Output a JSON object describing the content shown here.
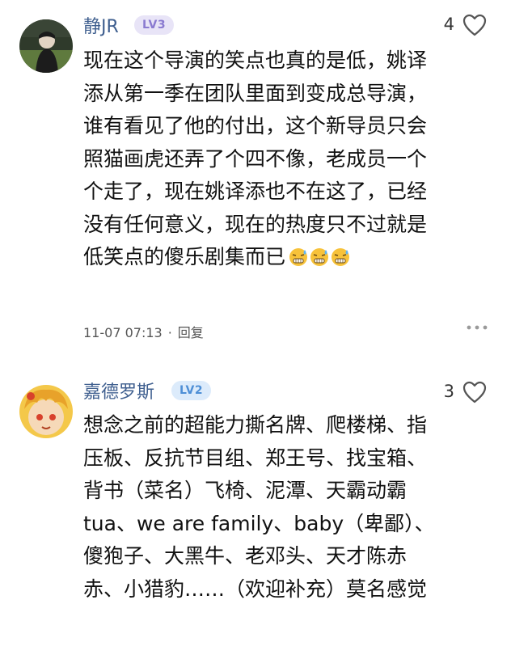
{
  "comments": [
    {
      "username": "静JR",
      "level": "LV3",
      "likes": "4",
      "lines": [
        "现在这个导演的笑点也真的是低，姚译",
        "添从第一季在团队里面到变成总导演，",
        "谁有看见了他的付出，这个新导员只会",
        "照猫画虎还弄了个四不像，老成员一个",
        "个走了，现在姚译添也不在这了，已经",
        "没有任何意义，现在的热度只不过就是",
        "低笑点的傻乐剧集而已"
      ],
      "emoji_icon": "grimacing-sweat-emoji",
      "emoji_count": 3,
      "timestamp": "11-07 07:13",
      "separator": "·",
      "reply_label": "回复"
    },
    {
      "username": "嘉德罗斯",
      "level": "LV2",
      "likes": "3",
      "lines": [
        "想念之前的超能力撕名牌、爬楼梯、指",
        "压板、反抗节目组、郑王号、找宝箱、",
        "背书（菜名）飞椅、泥潭、天霸动霸",
        "tua、we are family、baby（卑鄙）、",
        "傻狍子、大黑牛、老邓头、天才陈赤",
        "赤、小猎豹……（欢迎补充）莫名感觉"
      ]
    }
  ],
  "colors": {
    "username": "#3f5f8f",
    "lv3_bg": "#e8e4f7",
    "lv3_fg": "#8a7ad0",
    "lv2_bg": "#dcebfb",
    "lv2_fg": "#4e8fd6",
    "emoji_face": "#f7c23a"
  },
  "icons": {
    "like": "heart-outline-icon",
    "more": "more-dots-icon"
  }
}
